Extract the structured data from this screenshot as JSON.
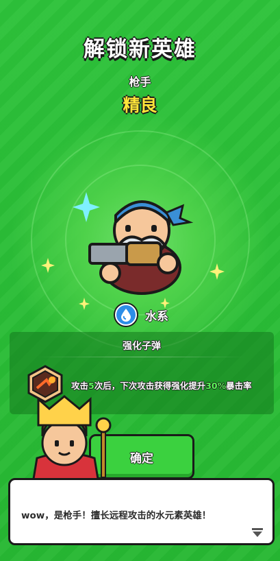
{
  "screen": {
    "title": "解锁新英雄",
    "hero_class": "枪手",
    "hero_rarity": "精良"
  },
  "hero": {
    "element_icon": "water-drop-icon",
    "element_label": "水系"
  },
  "skill": {
    "name": "强化子弹",
    "icon": "bullet-burst-icon",
    "desc_part1": "攻击",
    "desc_num1": "5",
    "desc_part2": "次后，下次攻击获得强化提升",
    "desc_num2": "30%",
    "desc_part3": "暴击率"
  },
  "confirm_button": {
    "label": "确定"
  },
  "dialog": {
    "text": "wow，是枪手！擅长远程攻击的水元素英雄！",
    "next_icon": "triangle-down-icon"
  },
  "colors": {
    "background": "#2fbf3a",
    "rarity": "#ffe53a",
    "highlight": "#5cff5a",
    "element": "#2d8ee8"
  }
}
